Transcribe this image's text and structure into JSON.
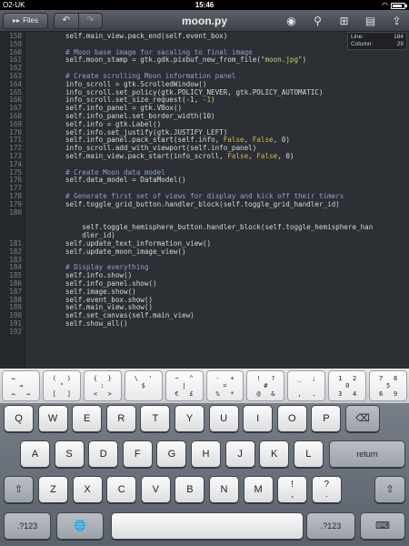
{
  "status": {
    "carrier": "O2-UK",
    "time": "15:46",
    "battery_level": 0.85
  },
  "toolbar": {
    "files_label": "Files",
    "undo": "↶",
    "redo": "↷",
    "title": "moon.py"
  },
  "info": {
    "line_label": "Line:",
    "line_value": "184",
    "column_label": "Column:",
    "column_value": "29"
  },
  "code": [
    {
      "num": "158",
      "segs": [
        {
          "t": "self.main_view.pack_end(self.event_box)"
        }
      ]
    },
    {
      "num": "159",
      "segs": []
    },
    {
      "num": "160",
      "segs": [
        {
          "t": "# Moon base image for sacaling to final image",
          "c": "cmt"
        }
      ]
    },
    {
      "num": "161",
      "segs": [
        {
          "t": "self.moon_stamp = gtk.gdk.pixbuf_new_from_file("
        },
        {
          "t": "\"moon.jpg\"",
          "c": "str"
        },
        {
          "t": ")"
        }
      ]
    },
    {
      "num": "162",
      "segs": []
    },
    {
      "num": "163",
      "segs": [
        {
          "t": "# Create scrolling Moon information panel",
          "c": "cmt"
        }
      ]
    },
    {
      "num": "164",
      "segs": [
        {
          "t": "info_scroll = gtk.ScrolledWindow()"
        }
      ]
    },
    {
      "num": "165",
      "segs": [
        {
          "t": "info_scroll.set_policy(gtk.POLICY_NEVER, gtk.POLICY_AUTOMATIC)"
        }
      ]
    },
    {
      "num": "166",
      "segs": [
        {
          "t": "info_scroll.set_size_request(-1, "
        },
        {
          "t": "-1",
          "c": "kw"
        },
        {
          "t": ")"
        }
      ]
    },
    {
      "num": "167",
      "segs": [
        {
          "t": "self.info_panel = gtk.VBox()"
        }
      ]
    },
    {
      "num": "168",
      "segs": [
        {
          "t": "self.info_panel.set_border_width(10)"
        }
      ]
    },
    {
      "num": "169",
      "segs": [
        {
          "t": "self.info = gtk.Label()"
        }
      ]
    },
    {
      "num": "170",
      "segs": [
        {
          "t": "self.info.set_justify(gtk.JUSTIFY_LEFT)"
        }
      ]
    },
    {
      "num": "171",
      "segs": [
        {
          "t": "self.info_panel.pack_start(self.info, "
        },
        {
          "t": "False",
          "c": "kw"
        },
        {
          "t": ", "
        },
        {
          "t": "False",
          "c": "kw"
        },
        {
          "t": ", 0)"
        }
      ]
    },
    {
      "num": "172",
      "segs": [
        {
          "t": "info_scroll.add_with_viewport(self.info_panel)"
        }
      ]
    },
    {
      "num": "173",
      "segs": [
        {
          "t": "self.main_view.pack_start(info_scroll, "
        },
        {
          "t": "False",
          "c": "kw"
        },
        {
          "t": ", "
        },
        {
          "t": "False",
          "c": "kw"
        },
        {
          "t": ", 0)"
        }
      ]
    },
    {
      "num": "174",
      "segs": []
    },
    {
      "num": "175",
      "segs": [
        {
          "t": "# Create Moon data model",
          "c": "cmt"
        }
      ]
    },
    {
      "num": "176",
      "segs": [
        {
          "t": "self.data_model = DataModel()"
        }
      ]
    },
    {
      "num": "177",
      "segs": []
    },
    {
      "num": "178",
      "segs": [
        {
          "t": "# Generate first set of views for display and kick off their timers",
          "c": "cmt"
        }
      ]
    },
    {
      "num": "179",
      "segs": [
        {
          "t": "self.toggle_grid_button.handler_block(self.toggle_grid_handler_id)"
        }
      ]
    },
    {
      "num": "180",
      "segs": [],
      "gap": true
    },
    {
      "num": "",
      "segs": [
        {
          "t": "    self.toggle_hemisphere_button.handler_block(self.toggle_hemisphere_han"
        }
      ]
    },
    {
      "num": "",
      "segs": [
        {
          "t": "    dler_id)"
        }
      ]
    },
    {
      "num": "181",
      "segs": [
        {
          "t": "self.update_text_information_view()"
        }
      ]
    },
    {
      "num": "182",
      "segs": [
        {
          "t": "self.update_moon_image_view()"
        }
      ]
    },
    {
      "num": "183",
      "segs": []
    },
    {
      "num": "184",
      "segs": [
        {
          "t": "# Display everything",
          "c": "cmt"
        }
      ]
    },
    {
      "num": "185",
      "segs": [
        {
          "t": "self.info.show()"
        }
      ]
    },
    {
      "num": "186",
      "segs": [
        {
          "t": "self.info_panel.show()"
        }
      ]
    },
    {
      "num": "187",
      "segs": [
        {
          "t": "self.image.show()"
        }
      ]
    },
    {
      "num": "188",
      "segs": [
        {
          "t": "self.event_box.show()"
        }
      ]
    },
    {
      "num": "189",
      "segs": [
        {
          "t": "self.main_view.show()"
        }
      ]
    },
    {
      "num": "190",
      "segs": [
        {
          "t": "self.set_canvas(self.main_view)"
        }
      ]
    },
    {
      "num": "191",
      "segs": [
        {
          "t": "self.show_all()"
        }
      ]
    },
    {
      "num": "192",
      "segs": []
    }
  ],
  "extra_keys": [
    {
      "tl": "←",
      "tr": "",
      "c": "⇥",
      "bl": "←",
      "br": "→"
    },
    {
      "tl": "(",
      "tr": ")",
      "c": "\"",
      "bl": "[",
      "br": "]"
    },
    {
      "tl": "{",
      "tr": "}",
      "c": ":",
      "bl": "<",
      "br": ">"
    },
    {
      "tl": "\\",
      "tr": "'",
      "c": "$",
      "bl": "",
      "br": ""
    },
    {
      "tl": "~",
      "tr": "^",
      "c": "|",
      "bl": "€",
      "br": "£"
    },
    {
      "tl": "-",
      "tr": "+",
      "c": "=",
      "bl": "%",
      "br": "*"
    },
    {
      "tl": "!",
      "tr": "?",
      "c": "#",
      "bl": "@",
      "br": "&"
    },
    {
      "tl": "_",
      "tr": ";",
      "c": "",
      "bl": ",",
      "br": "."
    },
    {
      "tl": "1",
      "tr": "2",
      "c": "0",
      "bl": "3",
      "br": "4"
    },
    {
      "tl": "7",
      "tr": "8",
      "c": "5",
      "bl": "6",
      "br": "9"
    }
  ],
  "keys": {
    "row1": [
      "Q",
      "W",
      "E",
      "R",
      "T",
      "Y",
      "U",
      "I",
      "O",
      "P"
    ],
    "row2": [
      "A",
      "S",
      "D",
      "F",
      "G",
      "H",
      "J",
      "K",
      "L"
    ],
    "row3": [
      "Z",
      "X",
      "C",
      "V",
      "B",
      "N",
      "M"
    ],
    "return_label": "return",
    "backspace": "⌫",
    "shift": "⇧",
    "num_label": ".?123",
    "globe": "🌐",
    "hide_kbd": "⌨",
    "excl_top": "!",
    "excl_bot": ",",
    "q_top": "?",
    "q_bot": "."
  }
}
